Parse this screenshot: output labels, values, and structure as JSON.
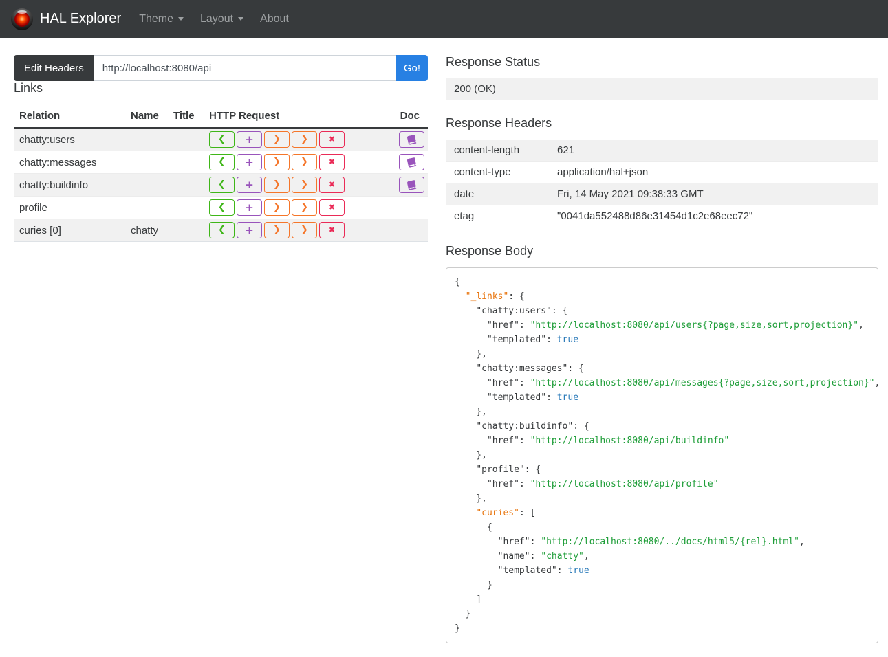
{
  "navbar": {
    "brand": "HAL Explorer",
    "items": [
      {
        "label": "Theme",
        "caret": true
      },
      {
        "label": "Layout",
        "caret": true
      },
      {
        "label": "About",
        "caret": false
      }
    ]
  },
  "request_bar": {
    "edit_headers_label": "Edit Headers",
    "url_value": "http://localhost:8080/api",
    "go_label": "Go!"
  },
  "links_section": {
    "title": "Links",
    "columns": [
      "Relation",
      "Name",
      "Title",
      "HTTP Request",
      "Doc"
    ],
    "rows": [
      {
        "relation": "chatty:users",
        "name": "",
        "title": "",
        "doc": true
      },
      {
        "relation": "chatty:messages",
        "name": "",
        "title": "",
        "doc": true
      },
      {
        "relation": "chatty:buildinfo",
        "name": "",
        "title": "",
        "doc": true
      },
      {
        "relation": "profile",
        "name": "",
        "title": "",
        "doc": false
      },
      {
        "relation": "curies [0]",
        "name": "chatty",
        "title": "",
        "doc": false
      }
    ],
    "request_buttons": [
      {
        "method": "get",
        "icon": "chevron-left-icon",
        "glyph": "❮"
      },
      {
        "method": "post",
        "icon": "plus-icon",
        "glyph": "+"
      },
      {
        "method": "put",
        "icon": "chevron-right-icon",
        "glyph": "❯"
      },
      {
        "method": "patch",
        "icon": "chevron-right-icon",
        "glyph": "❯"
      },
      {
        "method": "delete",
        "icon": "times-icon",
        "glyph": "✖"
      }
    ],
    "doc_icon": "book-icon"
  },
  "response_status": {
    "title": "Response Status",
    "value": "200 (OK)"
  },
  "response_headers": {
    "title": "Response Headers",
    "rows": [
      {
        "name": "content-length",
        "value": "621"
      },
      {
        "name": "content-type",
        "value": "application/hal+json"
      },
      {
        "name": "date",
        "value": "Fri, 14 May 2021 09:38:33 GMT"
      },
      {
        "name": "etag",
        "value": "\"0041da552488d86e31454d1c2e68eec72\""
      }
    ]
  },
  "response_body": {
    "title": "Response Body",
    "lines": [
      [
        {
          "t": "p",
          "v": "{"
        }
      ],
      [
        {
          "t": "p",
          "v": "  "
        },
        {
          "t": "h",
          "v": "\"_links\""
        },
        {
          "t": "p",
          "v": ": {"
        }
      ],
      [
        {
          "t": "p",
          "v": "    "
        },
        {
          "t": "k",
          "v": "\"chatty:users\""
        },
        {
          "t": "p",
          "v": ": {"
        }
      ],
      [
        {
          "t": "p",
          "v": "      "
        },
        {
          "t": "k",
          "v": "\"href\""
        },
        {
          "t": "p",
          "v": ": "
        },
        {
          "t": "s",
          "v": "\"http://localhost:8080/api/users{?page,size,sort,projection}\""
        },
        {
          "t": "p",
          "v": ","
        }
      ],
      [
        {
          "t": "p",
          "v": "      "
        },
        {
          "t": "k",
          "v": "\"templated\""
        },
        {
          "t": "p",
          "v": ": "
        },
        {
          "t": "b",
          "v": "true"
        }
      ],
      [
        {
          "t": "p",
          "v": "    },"
        }
      ],
      [
        {
          "t": "p",
          "v": "    "
        },
        {
          "t": "k",
          "v": "\"chatty:messages\""
        },
        {
          "t": "p",
          "v": ": {"
        }
      ],
      [
        {
          "t": "p",
          "v": "      "
        },
        {
          "t": "k",
          "v": "\"href\""
        },
        {
          "t": "p",
          "v": ": "
        },
        {
          "t": "s",
          "v": "\"http://localhost:8080/api/messages{?page,size,sort,projection}\""
        },
        {
          "t": "p",
          "v": ","
        }
      ],
      [
        {
          "t": "p",
          "v": "      "
        },
        {
          "t": "k",
          "v": "\"templated\""
        },
        {
          "t": "p",
          "v": ": "
        },
        {
          "t": "b",
          "v": "true"
        }
      ],
      [
        {
          "t": "p",
          "v": "    },"
        }
      ],
      [
        {
          "t": "p",
          "v": "    "
        },
        {
          "t": "k",
          "v": "\"chatty:buildinfo\""
        },
        {
          "t": "p",
          "v": ": {"
        }
      ],
      [
        {
          "t": "p",
          "v": "      "
        },
        {
          "t": "k",
          "v": "\"href\""
        },
        {
          "t": "p",
          "v": ": "
        },
        {
          "t": "s",
          "v": "\"http://localhost:8080/api/buildinfo\""
        }
      ],
      [
        {
          "t": "p",
          "v": "    },"
        }
      ],
      [
        {
          "t": "p",
          "v": "    "
        },
        {
          "t": "k",
          "v": "\"profile\""
        },
        {
          "t": "p",
          "v": ": {"
        }
      ],
      [
        {
          "t": "p",
          "v": "      "
        },
        {
          "t": "k",
          "v": "\"href\""
        },
        {
          "t": "p",
          "v": ": "
        },
        {
          "t": "s",
          "v": "\"http://localhost:8080/api/profile\""
        }
      ],
      [
        {
          "t": "p",
          "v": "    },"
        }
      ],
      [
        {
          "t": "p",
          "v": "    "
        },
        {
          "t": "h",
          "v": "\"curies\""
        },
        {
          "t": "p",
          "v": ": ["
        }
      ],
      [
        {
          "t": "p",
          "v": "      {"
        }
      ],
      [
        {
          "t": "p",
          "v": "        "
        },
        {
          "t": "k",
          "v": "\"href\""
        },
        {
          "t": "p",
          "v": ": "
        },
        {
          "t": "s",
          "v": "\"http://localhost:8080/../docs/html5/{rel}.html\""
        },
        {
          "t": "p",
          "v": ","
        }
      ],
      [
        {
          "t": "p",
          "v": "        "
        },
        {
          "t": "k",
          "v": "\"name\""
        },
        {
          "t": "p",
          "v": ": "
        },
        {
          "t": "s",
          "v": "\"chatty\""
        },
        {
          "t": "p",
          "v": ","
        }
      ],
      [
        {
          "t": "p",
          "v": "        "
        },
        {
          "t": "k",
          "v": "\"templated\""
        },
        {
          "t": "p",
          "v": ": "
        },
        {
          "t": "b",
          "v": "true"
        }
      ],
      [
        {
          "t": "p",
          "v": "      }"
        }
      ],
      [
        {
          "t": "p",
          "v": "    ]"
        }
      ],
      [
        {
          "t": "p",
          "v": "  }"
        }
      ],
      [
        {
          "t": "p",
          "v": "}"
        }
      ]
    ]
  },
  "colors": {
    "navbar_bg": "#373a3c",
    "primary_blue": "#2780e3",
    "get_green": "#3fb618",
    "post_purple": "#9954bb",
    "put_patch_orange": "#f5762a",
    "delete_red": "#ea2b57",
    "stripe_gray": "#f1f1f1",
    "json_hal_key": "#e8750e",
    "json_string": "#1f9e39",
    "json_bool": "#2a7ab9",
    "json_text": "#373a3c"
  }
}
